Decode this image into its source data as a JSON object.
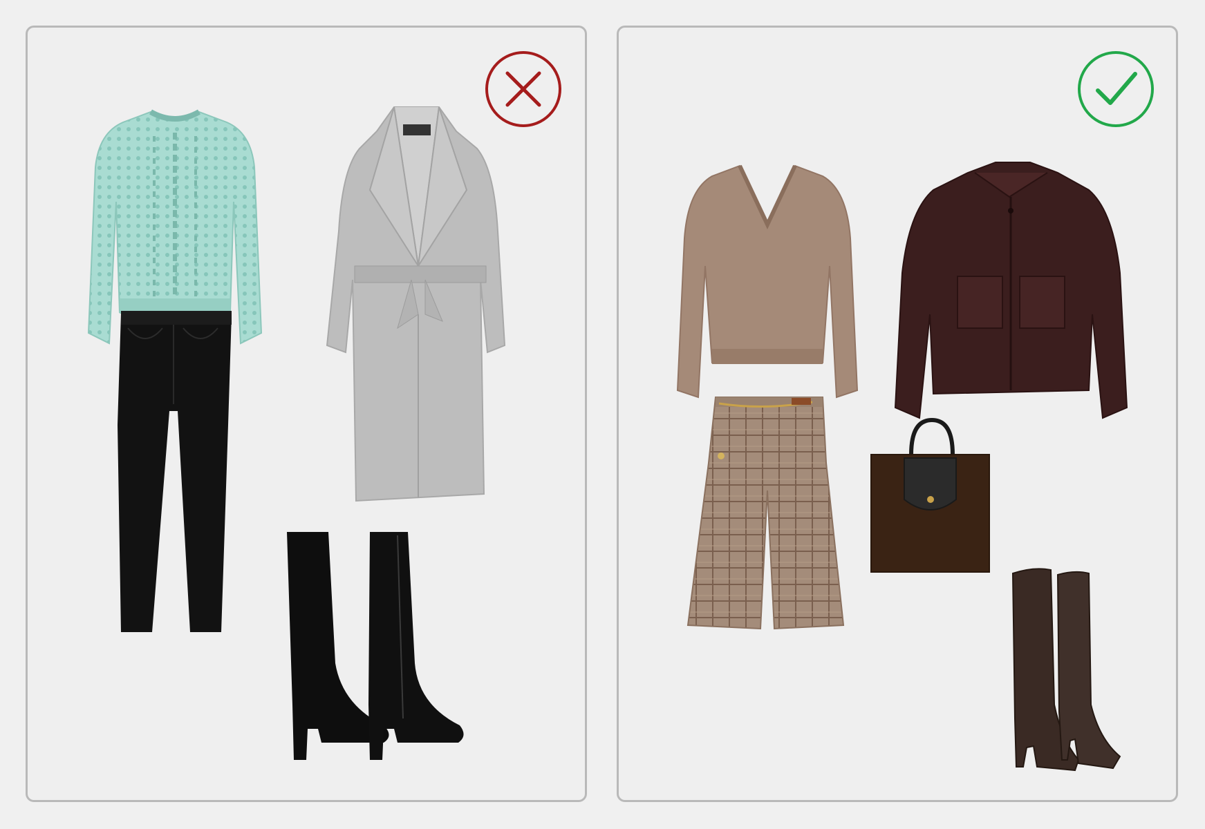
{
  "colors": {
    "background": "#f0f0f0",
    "panel_border": "#b9b9b9",
    "bad_mark": "#a51c1c",
    "good_mark": "#22a84a"
  },
  "panels": [
    {
      "verdict": "incorrect",
      "badge_icon": "cross-circle-icon",
      "items": [
        "mint-cable-knit-sweater",
        "black-skinny-jeans",
        "grey-belted-wrap-coat",
        "black-suede-knee-high-boots"
      ]
    },
    {
      "verdict": "correct",
      "badge_icon": "check-circle-icon",
      "items": [
        "taupe-v-neck-sweater",
        "plaid-culottes-with-chain-belt",
        "burgundy-leather-jacket",
        "brown-suede-tote-bag",
        "brown-leather-knee-high-boots"
      ]
    }
  ]
}
